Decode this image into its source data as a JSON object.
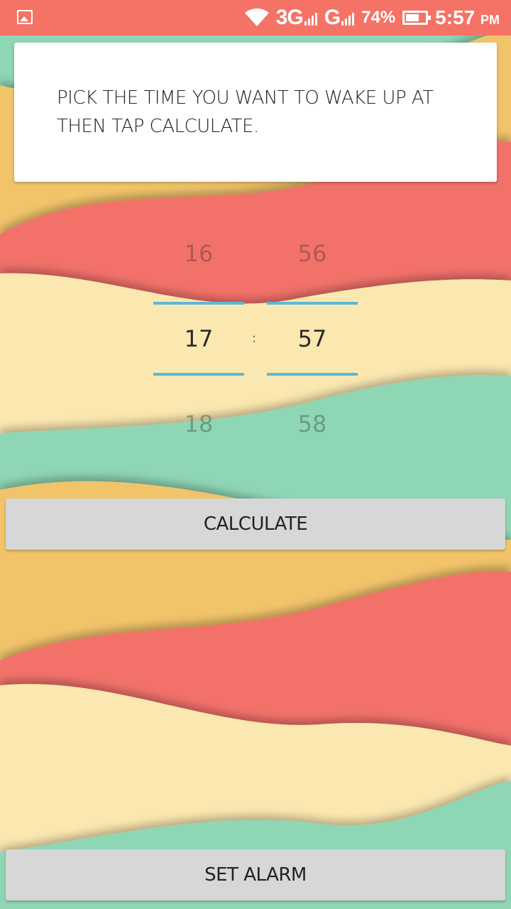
{
  "status_bar": {
    "network_1": "3G",
    "network_2": "G",
    "battery": "74%",
    "time": "5:57",
    "ampm": "PM",
    "color": "#f47366"
  },
  "instructions": {
    "text": "PICK THE TIME YOU WANT TO WAKE UP AT THEN TAP CALCULATE."
  },
  "time_picker": {
    "hours": {
      "prev": "16",
      "current": "17",
      "next": "18"
    },
    "minutes": {
      "prev": "56",
      "current": "57",
      "next": "58"
    },
    "separator": ":",
    "accent": "#5bb8d9"
  },
  "buttons": {
    "calculate": "CALCULATE",
    "set_alarm": "SET ALARM"
  },
  "background_colors": {
    "yellow": "#f2c46a",
    "red": "#f2726a",
    "cream": "#fbe8b0",
    "mint": "#8fd6b5"
  },
  "icons": {
    "gallery": "gallery-icon",
    "wifi": "wifi-icon",
    "battery": "battery-icon"
  }
}
